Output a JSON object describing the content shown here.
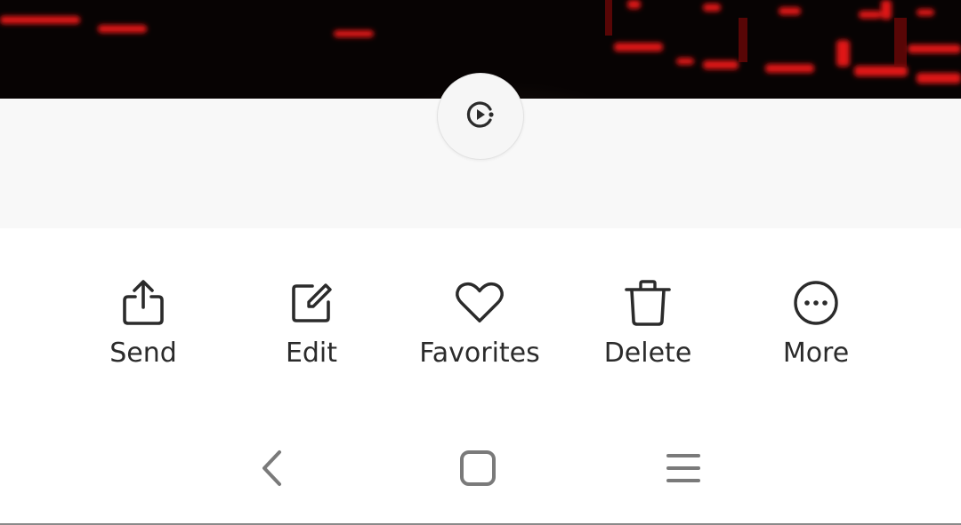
{
  "colors": {
    "photo_background": "#070303",
    "photo_glow": "#e01010",
    "panel_background": "#f8f8f8",
    "icon_color": "#2b2b2b",
    "nav_icon_color": "#7a7a7a"
  },
  "viewer": {
    "motion_button_icon": "motion-photo-icon"
  },
  "actions": [
    {
      "id": "send",
      "label": "Send",
      "icon": "share-icon"
    },
    {
      "id": "edit",
      "label": "Edit",
      "icon": "edit-icon"
    },
    {
      "id": "favorites",
      "label": "Favorites",
      "icon": "heart-icon"
    },
    {
      "id": "delete",
      "label": "Delete",
      "icon": "trash-icon"
    },
    {
      "id": "more",
      "label": "More",
      "icon": "more-icon"
    }
  ],
  "navigation": {
    "back_icon": "back-icon",
    "home_icon": "home-icon",
    "recents_icon": "recents-icon"
  }
}
